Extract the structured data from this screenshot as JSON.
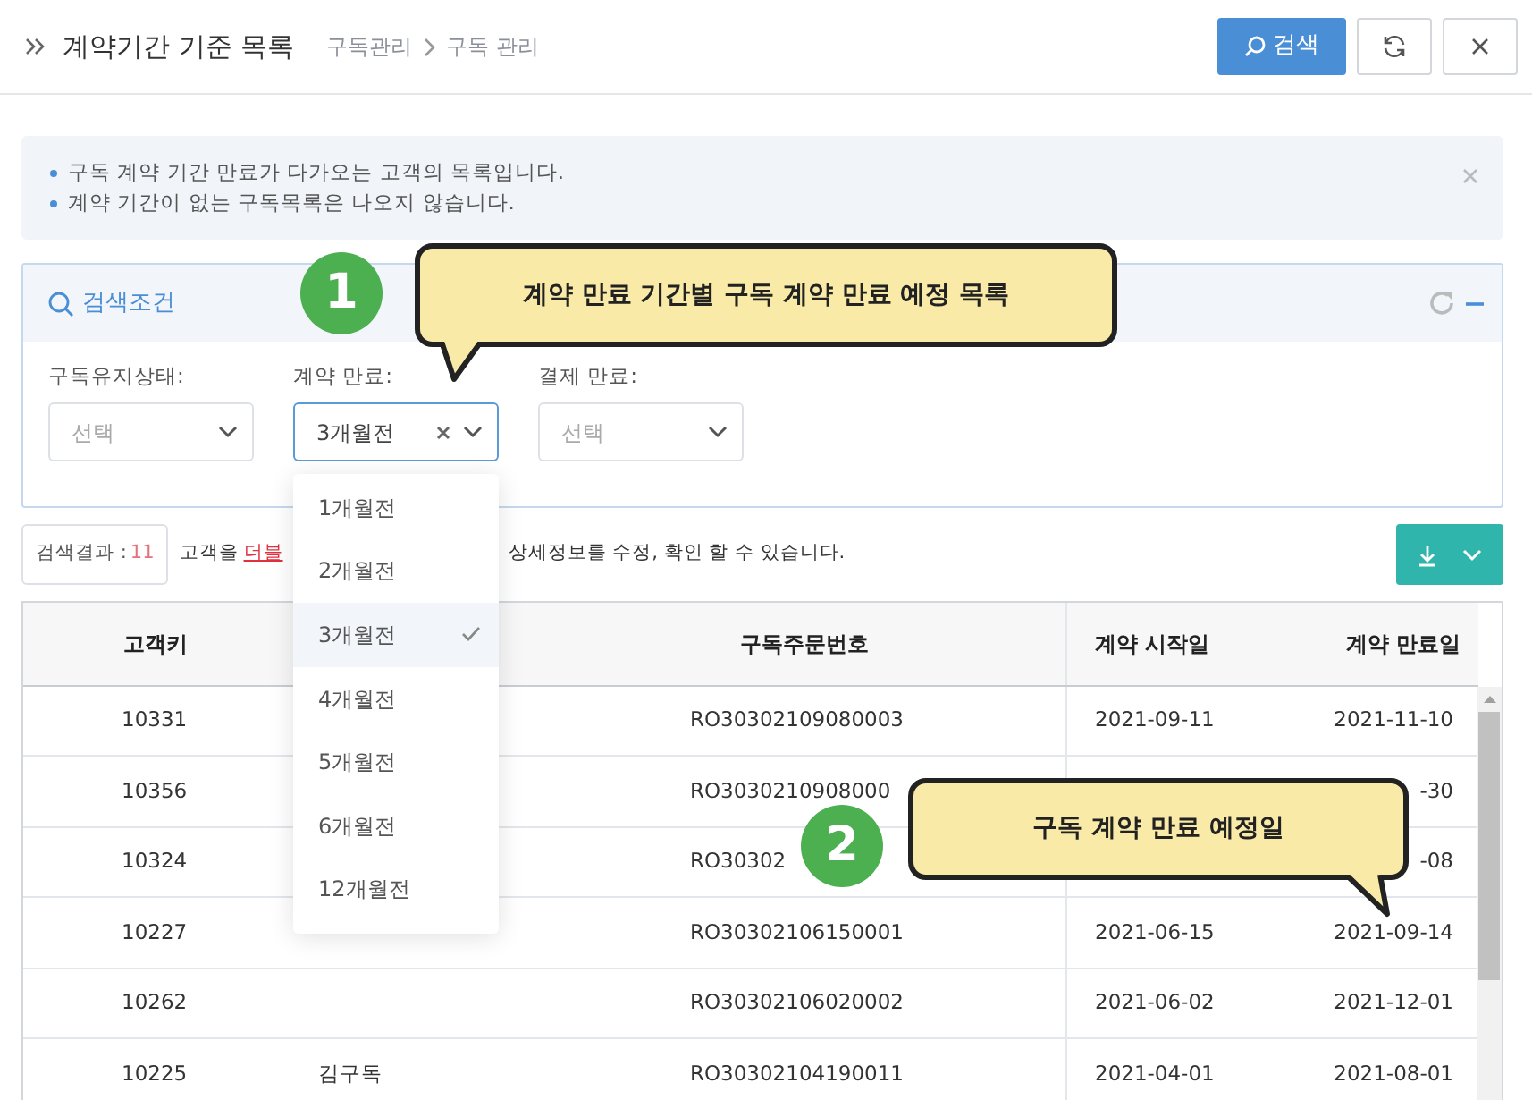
{
  "header": {
    "title": "계약기간 기준 목록",
    "breadcrumb": [
      "구독관리",
      "구독 관리"
    ],
    "buttons": [
      {
        "kind": "search",
        "label": "검색"
      },
      {
        "kind": "refresh"
      },
      {
        "kind": "close"
      }
    ]
  },
  "notice": {
    "lines": [
      "구독 계약 기간 만료가 다가오는 고객의 목록입니다.",
      "계약 기간이 없는 구독목록은 나오지 않습니다."
    ]
  },
  "search_panel": {
    "title": "검색조건",
    "filters": [
      {
        "label": "구독유지상태:",
        "placeholder": "선택"
      },
      {
        "label": "계약 만료:",
        "value": "3개월전",
        "expanded": true,
        "options": [
          {
            "label": "1개월전",
            "selected": false
          },
          {
            "label": "2개월전",
            "selected": false
          },
          {
            "label": "3개월전",
            "selected": true
          },
          {
            "label": "4개월전",
            "selected": false
          },
          {
            "label": "5개월전",
            "selected": false
          },
          {
            "label": "6개월전",
            "selected": false
          },
          {
            "label": "12개월전",
            "selected": false
          }
        ]
      },
      {
        "label": "결제 만료:",
        "placeholder": "선택"
      }
    ]
  },
  "results": {
    "count_label": "검색결과 :",
    "count": "11",
    "hint_start": "고객을",
    "hint_link": "더블",
    "hint_end": "상세정보를 수정, 확인 할 수 있습니다."
  },
  "table": {
    "columns": [
      {
        "label": "고객키"
      },
      {
        "label": "구독주문번호"
      },
      {
        "label": "계약 시작일"
      },
      {
        "label": "계약 만료일"
      }
    ],
    "rows": [
      {
        "customer_key": "10331",
        "order_no": "RO30302109080003",
        "start_date": "2021-09-11",
        "end_date": "2021-11-10"
      },
      {
        "customer_key": "10356",
        "order_no": "RO3030210908000",
        "end_date": "-30"
      },
      {
        "customer_key": "10324",
        "order_no": "RO30302",
        "end_date": "-08"
      },
      {
        "customer_key": "10227",
        "order_no": "RO30302106150001",
        "start_date": "2021-06-15",
        "end_date": "2021-09-14"
      },
      {
        "customer_key": "10262",
        "order_no": "RO30302106020002",
        "start_date": "2021-06-02",
        "end_date": "2021-12-01"
      },
      {
        "customer_key": "10225",
        "column_2": "김구독",
        "order_no": "RO30302104190011",
        "start_date": "2021-04-01",
        "end_date": "2021-08-01"
      }
    ]
  },
  "callouts": [
    {
      "number": "1",
      "text": "계약 만료 기간별 구독 계약 만료 예정 목록"
    },
    {
      "number": "2",
      "text": "구독 계약 만료 예정일"
    }
  ]
}
